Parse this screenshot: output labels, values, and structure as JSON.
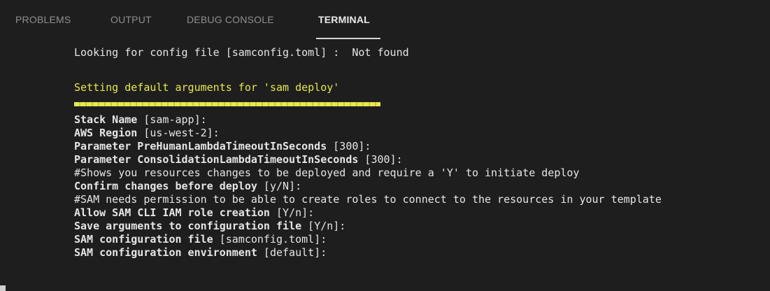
{
  "tabs": [
    {
      "label": "PROBLEMS"
    },
    {
      "label": "OUTPUT"
    },
    {
      "label": "DEBUG CONSOLE"
    },
    {
      "label": "TERMINAL"
    }
  ],
  "terminal": {
    "config_line": "Looking for config file [samconfig.toml] :  Not found",
    "heading": "Setting default arguments for 'sam deploy'",
    "separator": "=========================================",
    "prompts": [
      {
        "label": "Stack Name",
        "rest": " [sam-app]:"
      },
      {
        "label": "AWS Region",
        "rest": " [us-west-2]:"
      },
      {
        "label": "Parameter PreHumanLambdaTimeoutInSeconds",
        "rest": " [300]:"
      },
      {
        "label": "Parameter ConsolidationLambdaTimeoutInSeconds",
        "rest": " [300]:"
      },
      {
        "label": "",
        "rest": "#Shows you resources changes to be deployed and require a 'Y' to initiate deploy"
      },
      {
        "label": "Confirm changes before deploy",
        "rest": " [y/N]:"
      },
      {
        "label": "",
        "rest": "#SAM needs permission to be able to create roles to connect to the resources in your template"
      },
      {
        "label": "Allow SAM CLI IAM role creation",
        "rest": " [Y/n]:"
      },
      {
        "label": "Save arguments to configuration file",
        "rest": " [Y/n]:"
      },
      {
        "label": "SAM configuration file",
        "rest": " [samconfig.toml]:"
      },
      {
        "label": "SAM configuration environment",
        "rest": " [default]:"
      }
    ]
  }
}
